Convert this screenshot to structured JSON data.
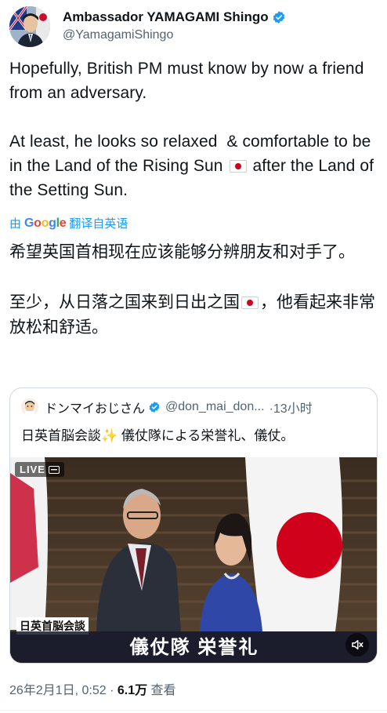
{
  "author": {
    "display_name": "Ambassador YAMAGAMI Shingo",
    "handle": "@YamagamiShingo",
    "avatar_icon": "ambassador-portrait-avatar"
  },
  "tweet": {
    "text": "Hopefully, British PM must know by now a friend from an adversary.\n\nAt least, he looks so relaxed  & comfortable to be in the Land of the Rising Sun ",
    "text_after_flag": " after the Land of the Setting Sun.",
    "translate": {
      "prefix": "由",
      "brand": "Google",
      "suffix": "翻译自英语"
    },
    "translated_text_1": "希望英国首相现在应该能够分辨朋友和对手了。\n\n至少，从日落之国来到日出之国",
    "translated_text_2": "，他看起来非常放松和舒适。"
  },
  "quoted": {
    "name": "ドンマイおじさん",
    "handle": "@don_mai_don...",
    "time": "·13小时",
    "text": "日英首脳会談",
    "text_after_sparkle": " 儀仗隊による栄誉礼、儀仗。",
    "video": {
      "live_label": "LIVE",
      "caption_small": "日英首脳会談",
      "caption_big": "儀仗隊 栄誉礼"
    }
  },
  "meta": {
    "timestamp": "26年2月1日, 0:52 · ",
    "views": "6.1万",
    "views_suffix": " 查看"
  },
  "colors": {
    "link": "#1d9bf0",
    "verified": "#1d9bf0",
    "secondary_text": "#536471"
  }
}
